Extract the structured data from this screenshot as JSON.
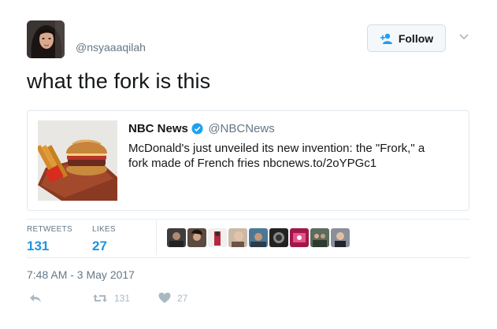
{
  "user": {
    "handle": "@nsyaaaqilah"
  },
  "follow_button": {
    "label": "Follow"
  },
  "tweet": {
    "text": "what the fork is this"
  },
  "card": {
    "name": "NBC News",
    "handle": "@NBCNews",
    "text": "McDonald's just unveiled its new invention: the \"Frork,\" a fork made of French fries nbcnews.to/2oYPGc1"
  },
  "stats": {
    "retweets_label": "RETWEETS",
    "retweets_value": "131",
    "likes_label": "LIKES",
    "likes_value": "27"
  },
  "timestamp": "7:48 AM - 3 May 2017",
  "actions": {
    "retweet_count": "131",
    "like_count": "27"
  },
  "colors": {
    "link_blue": "#1b95e0",
    "secondary_gray": "#657786",
    "border": "#e1e8ed",
    "verified_blue": "#1da1f2"
  },
  "icons": [
    "follow-person-plus-icon",
    "chevron-down-icon",
    "verified-badge-icon",
    "reply-icon",
    "retweet-icon",
    "heart-icon"
  ]
}
